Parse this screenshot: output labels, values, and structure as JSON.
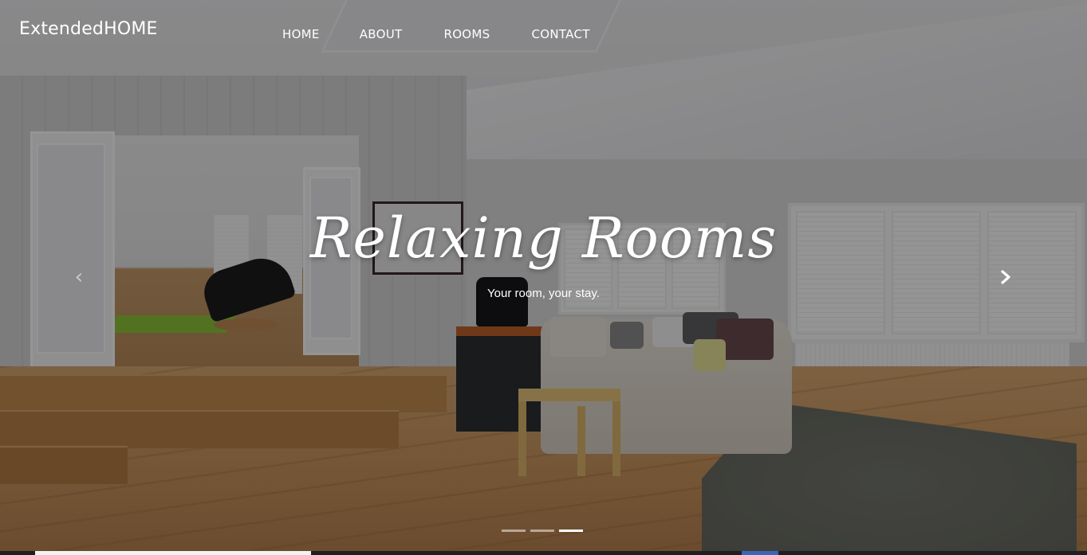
{
  "brand": {
    "name": "ExtendedHOME"
  },
  "nav": {
    "items": [
      {
        "label": "HOME"
      },
      {
        "label": "ABOUT"
      },
      {
        "label": "ROOMS"
      },
      {
        "label": "CONTACT"
      }
    ]
  },
  "carousel": {
    "caption_title": "Relaxing Rooms",
    "caption_subtitle": "Your room, your stay.",
    "prev_icon": "chevron-left-icon",
    "next_icon": "chevron-right-icon",
    "slide_count": 3,
    "active_slide": 3
  },
  "colors": {
    "text": "#ffffff",
    "overlay": "rgba(0,0,0,0.42)"
  }
}
